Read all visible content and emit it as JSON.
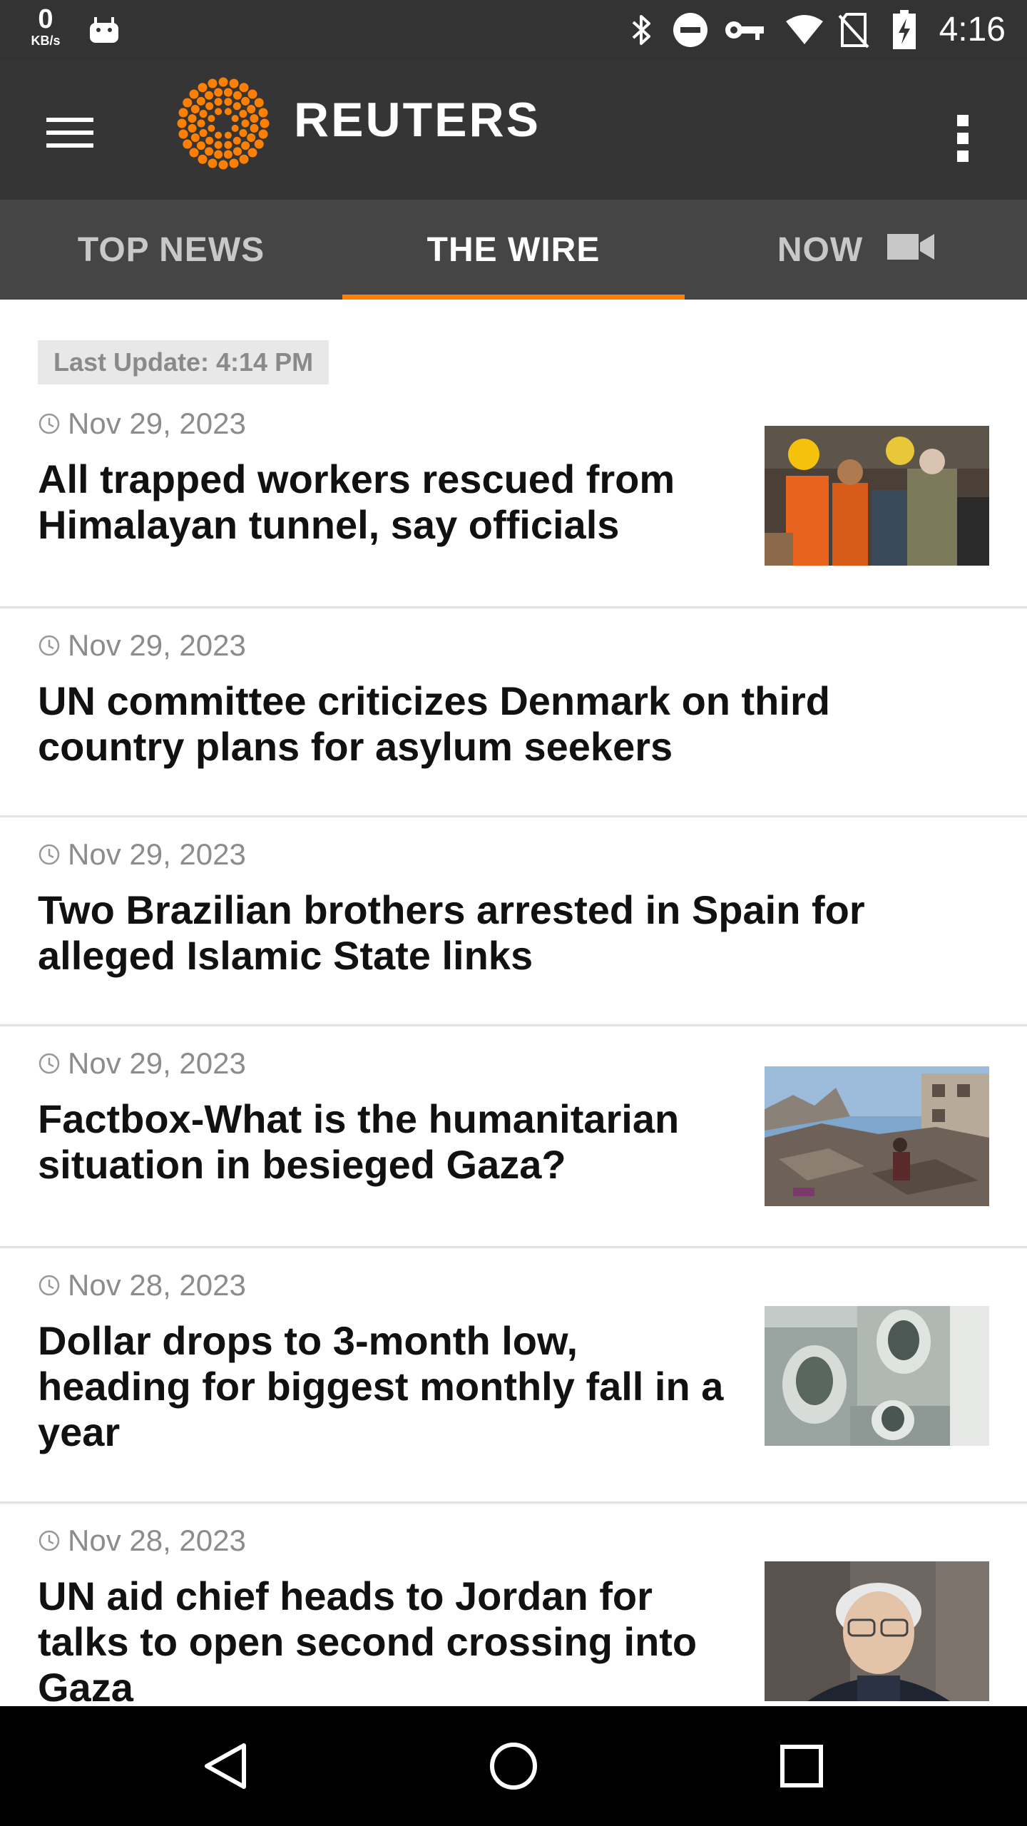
{
  "status_bar": {
    "net_speed": "0",
    "net_unit": "KB/s",
    "time": "4:16",
    "icons": [
      "android-icon",
      "bluetooth-icon",
      "do-not-disturb-icon",
      "vpn-key-icon",
      "wifi-icon",
      "no-sim-icon",
      "battery-charging-icon"
    ]
  },
  "app_bar": {
    "brand": "REUTERS",
    "menu_icon": "hamburger-menu-icon",
    "overflow_icon": "more-vertical-icon",
    "logo_color": "#ff8000"
  },
  "tabs": [
    {
      "label": "TOP NEWS",
      "active": false
    },
    {
      "label": "THE WIRE",
      "active": true
    },
    {
      "label": "NOW",
      "active": false,
      "icon": "video-camera-icon"
    }
  ],
  "accent_color": "#ff8000",
  "feed": {
    "last_update": "Last Update: 4:14 PM",
    "articles": [
      {
        "date": "Nov 29, 2023",
        "headline_lines": [
          "All trapped workers rescued from",
          "Himalayan tunnel, say officials"
        ],
        "has_image": true,
        "image_subject": "rescue workers in hard hats"
      },
      {
        "date": "Nov 29, 2023",
        "headline_lines": [
          "UN committee criticizes Denmark on third",
          "country plans for asylum seekers"
        ],
        "has_image": false
      },
      {
        "date": "Nov 29, 2023",
        "headline_lines": [
          "Two Brazilian brothers arrested in Spain for",
          "alleged Islamic State links"
        ],
        "has_image": false
      },
      {
        "date": "Nov 29, 2023",
        "headline_lines": [
          "Factbox-What is the humanitarian",
          "situation in besieged Gaza?"
        ],
        "has_image": true,
        "image_subject": "destroyed buildings rubble"
      },
      {
        "date": "Nov 28, 2023",
        "headline_lines": [
          "Dollar drops to 3-month low,",
          "heading for biggest monthly fall in a",
          "year"
        ],
        "has_image": true,
        "image_subject": "US dollar banknotes"
      },
      {
        "date": "Nov 28, 2023",
        "headline_lines": [
          "UN aid chief heads to Jordan for",
          "talks to open second crossing into",
          "Gaza"
        ],
        "has_image": true,
        "image_subject": "portrait of grey-haired man with glasses"
      }
    ]
  },
  "nav_bar": {
    "back_icon": "back-triangle-icon",
    "home_icon": "home-circle-icon",
    "recents_icon": "recents-square-icon"
  }
}
